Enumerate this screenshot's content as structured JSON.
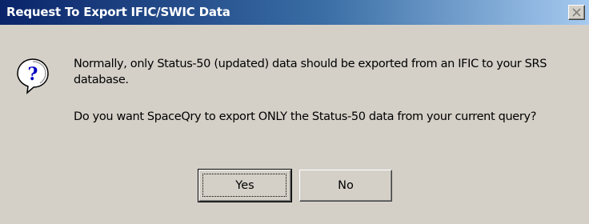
{
  "dialog": {
    "title": "Request To Export IFIC/SWIC Data",
    "close_icon": "close-icon",
    "message_icon": "question-icon",
    "message_line1": "Normally, only Status-50 (updated) data should be exported from an IFIC to your SRS",
    "message_line2": "database.",
    "message_line3": "Do you want SpaceQry to export ONLY the Status-50 data from your current query?",
    "buttons": {
      "yes_label": "Yes",
      "no_label": "No"
    }
  },
  "colors": {
    "titlebar_start": "#0a246a",
    "titlebar_end": "#a6caf0",
    "face": "#d4d0c8",
    "icon_bubble": "#ffffff",
    "icon_mark": "#0000c0"
  }
}
